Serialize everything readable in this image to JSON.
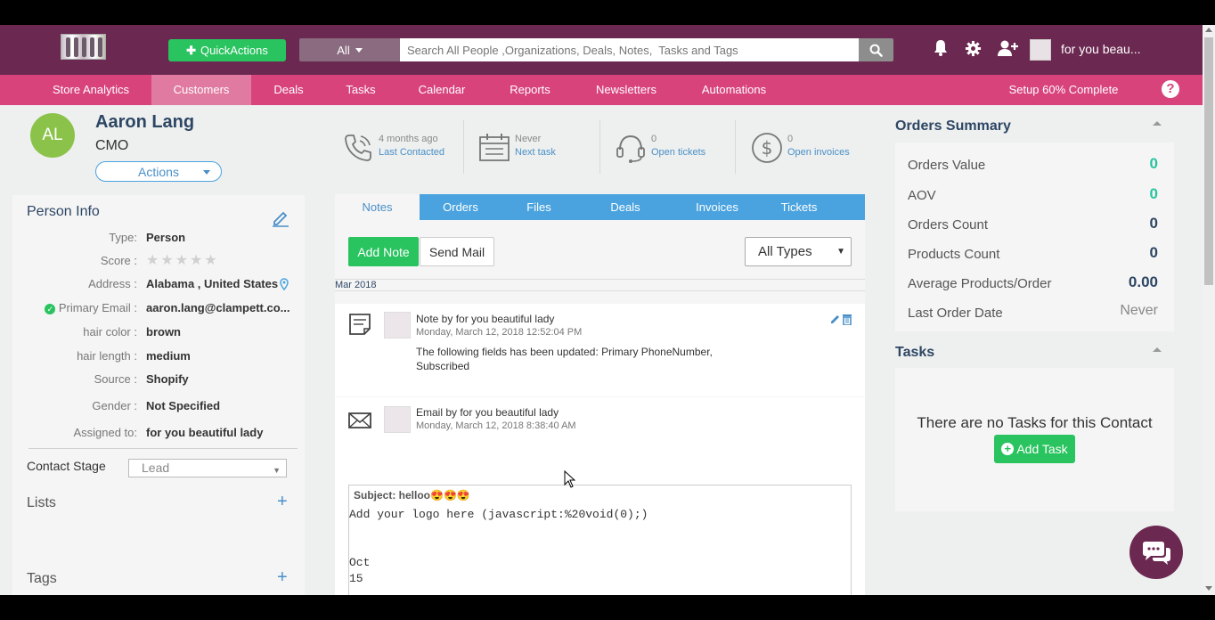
{
  "header": {
    "quick_actions": "QuickActions",
    "search_scope": "All",
    "search_placeholder": "Search All People ,Organizations, Deals, Notes,  Tasks and Tags",
    "user_name": "for you beau..."
  },
  "nav": {
    "items": [
      "Store Analytics",
      "Customers",
      "Deals",
      "Tasks",
      "Calendar",
      "Reports",
      "Newsletters",
      "Automations"
    ],
    "active": "Customers",
    "setup": "Setup 60% Complete"
  },
  "contact": {
    "initials": "AL",
    "name": "Aaron Lang",
    "title": "CMO",
    "actions_label": "Actions"
  },
  "stats": [
    {
      "top": "4 months ago",
      "link": "Last Contacted",
      "icon": "phone-icon"
    },
    {
      "top": "Never",
      "link": "Next task",
      "icon": "calendar-icon"
    },
    {
      "top": "0",
      "link": "Open tickets",
      "icon": "headset-icon"
    },
    {
      "top": "0",
      "link": "Open invoices",
      "icon": "dollar-icon"
    }
  ],
  "person_info": {
    "title": "Person Info",
    "rows": [
      {
        "label": "Type:",
        "value": "Person"
      },
      {
        "label": "Score :",
        "value": ""
      },
      {
        "label": "Address :",
        "value": "Alabama , United States"
      },
      {
        "label": "Primary Email :",
        "value": "aaron.lang@clampett.co..."
      },
      {
        "label": "hair color :",
        "value": "brown"
      },
      {
        "label": "hair length :",
        "value": "medium"
      },
      {
        "label": "Source :",
        "value": "Shopify"
      },
      {
        "label": "Gender :",
        "value": "Not Specified"
      },
      {
        "label": "Assigned to:",
        "value": "for you beautiful lady"
      }
    ],
    "score_stars": 0,
    "contact_stage_label": "Contact Stage",
    "contact_stage_value": "Lead",
    "lists_label": "Lists",
    "tags_label": "Tags"
  },
  "tabs": [
    "Notes",
    "Orders",
    "Files",
    "Deals",
    "Invoices",
    "Tickets"
  ],
  "active_tab": "Notes",
  "notes": {
    "add_note": "Add Note",
    "send_mail": "Send Mail",
    "filter": "All Types",
    "month": "Mar 2018",
    "items": [
      {
        "title": "Note by for you beautiful lady",
        "date": "Monday, March 12, 2018 12:52:04 PM",
        "body": "The following fields has been updated: Primary PhoneNumber, Subscribed"
      },
      {
        "title": "Email by for you beautiful lady",
        "date": "Monday, March 12, 2018 8:38:40 AM",
        "subject": "Subject: helloo😍😍😍",
        "lines": [
          "Add your logo here (javascript:%20void(0);)",
          "",
          "",
          "Oct",
          "15"
        ]
      }
    ]
  },
  "orders_summary": {
    "title": "Orders Summary",
    "rows": [
      {
        "label": "Orders Value",
        "value": "0"
      },
      {
        "label": "AOV",
        "value": "0"
      },
      {
        "label": "Orders Count",
        "value": "0"
      },
      {
        "label": "Products Count",
        "value": "0"
      },
      {
        "label": "Average Products/Order",
        "value": "0.00"
      },
      {
        "label": "Last Order Date",
        "value": "Never"
      }
    ]
  },
  "tasks": {
    "title": "Tasks",
    "empty": "There are no Tasks for this Contact",
    "add_task": "Add Task"
  },
  "colors": {
    "topbar": "#6b2850",
    "nav": "#d8437c",
    "accent_green": "#29c35f",
    "tab_blue": "#4aa3df"
  }
}
